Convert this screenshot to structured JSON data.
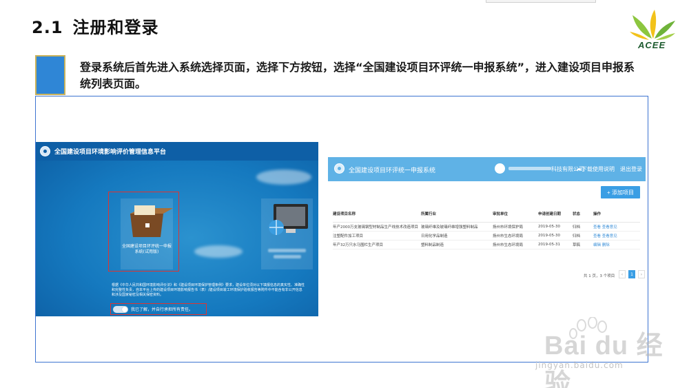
{
  "slide": {
    "number": "2.1",
    "title": "注册和登录",
    "logo_text": "ACEE",
    "intro": "登录系统后首先进入系统选择页面，选择下方按钮，选择“全国建设项目环评统一申报系统”，进入建设项目申报系统列表页面。"
  },
  "left_screen": {
    "header_title": "全国建设项目环境影响评价管理信息平台",
    "tile1_label": "全国建设项目环评统一申报系统(试用版)",
    "notice_lead": "根据《中华人民共和国环境影响评价法》和《建设项目环境保护管理条例》要求，建设单位须对以下填报信息的真实性、准确性和完整性负责，自本平台上传的建设项目环境影响报告书（表）/建设项目竣工环境保护验收报告等附件中不能含有非公开信息和涉及国家秘密及相关保密资料。",
    "agree_text": "我已了解，并自行承担所有责任。"
  },
  "right_screen": {
    "header_title": "全国建设项目环评统一申报系统",
    "user_suffix": "科技有限公司",
    "help": "下载使用说明",
    "logout": "退出登录",
    "add_button": "+ 添加项目",
    "columns": [
      "建设项目名称",
      "所属行业",
      "审批单位",
      "申请创建日期",
      "状态",
      "操作"
    ],
    "rows": [
      [
        "年产2000万支玻璃钢型材制品生产线技术改造项目",
        "玻璃纤维及玻璃纤维增强塑料制品",
        "扬州市环境保护局",
        "2019-05-30",
        "归档",
        "查看 查看意见"
      ],
      [
        "注塑配件加工项目",
        "日用化学品制造",
        "扬州市生态环境局",
        "2019-05-30",
        "归档",
        "查看 查看意见"
      ],
      [
        "年产32万只水马围栏生产项目",
        "塑料制品制造",
        "扬州市生态环境局",
        "2019-05-31",
        "草稿",
        "编辑 删除"
      ]
    ],
    "pager_text": "共 1 页，3 个项目",
    "pager_prev": "‹",
    "pager_current": "1",
    "pager_next": "›"
  },
  "watermark": {
    "brand": "Bai du 经验",
    "url": "jingyan.baidu.com"
  },
  "colors": {
    "accent_blue": "#2f86d6",
    "frame_border": "#3c73d0",
    "highlight_red": "#e2332f",
    "header_light_blue": "#5fb2e6"
  }
}
